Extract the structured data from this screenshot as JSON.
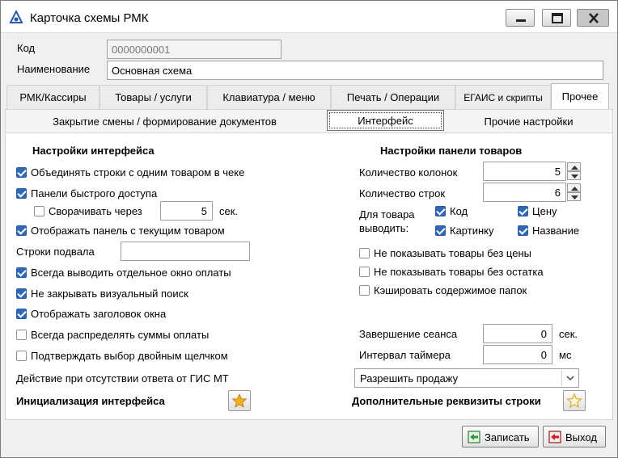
{
  "window": {
    "title": "Карточка схемы РМК"
  },
  "fields": {
    "code_label": "Код",
    "code_value": "0000000001",
    "name_label": "Наименование",
    "name_value": "Основная схема"
  },
  "tabs": [
    {
      "label": "РМК/Кассиры"
    },
    {
      "label": "Товары / услуги"
    },
    {
      "label": "Клавиатура / меню"
    },
    {
      "label": "Печать / Операции"
    },
    {
      "label": "ЕГАИС и скрипты"
    },
    {
      "label": "Прочее",
      "active": true
    }
  ],
  "subtabs": [
    {
      "label": "Закрытие смены / формирование документов"
    },
    {
      "label": "Интерфейс",
      "active": true
    },
    {
      "label": "Прочие настройки"
    }
  ],
  "left": {
    "section_title": "Настройки интерфейса",
    "group_lines": {
      "label": "Объединять строки с одним товаром в чеке",
      "checked": true
    },
    "quick_panels": {
      "label": "Панели быстрого доступа",
      "checked": true
    },
    "collapse": {
      "label": "Сворачивать через",
      "checked": false,
      "value": "5",
      "unit": "сек."
    },
    "show_current": {
      "label": "Отображать панель с текущим товаром",
      "checked": true
    },
    "footer_lines": {
      "label": "Строки подвала",
      "value": ""
    },
    "separate_payment": {
      "label": "Всегда выводить отдельное окно оплаты",
      "checked": true
    },
    "keep_search": {
      "label": "Не закрывать визуальный поиск",
      "checked": true
    },
    "show_header": {
      "label": "Отображать заголовок окна",
      "checked": true
    },
    "distribute_sums": {
      "label": "Всегда распределять суммы оплаты",
      "checked": false
    },
    "confirm_dblclick": {
      "label": "Подтверждать выбор двойным щелчком",
      "checked": false
    },
    "gis_action_label": "Действие при отсутствии ответа от ГИС МТ",
    "init_label": "Инициализация интерфейса"
  },
  "right": {
    "section_title": "Настройки панели товаров",
    "columns": {
      "label": "Количество колонок",
      "value": "5"
    },
    "rows": {
      "label": "Количество строк",
      "value": "6"
    },
    "output_label_1": "Для товара",
    "output_label_2": "выводить:",
    "out_code": {
      "label": "Код",
      "checked": true
    },
    "out_price": {
      "label": "Цену",
      "checked": true
    },
    "out_image": {
      "label": "Картинку",
      "checked": true
    },
    "out_name": {
      "label": "Название",
      "checked": true
    },
    "hide_no_price": {
      "label": "Не показывать товары без цены",
      "checked": false
    },
    "hide_no_stock": {
      "label": "Не показывать товары без остатка",
      "checked": false
    },
    "cache_folders": {
      "label": "Кэшировать содержимое папок",
      "checked": false
    },
    "session_end": {
      "label": "Завершение сеанса",
      "value": "0",
      "unit": "сек."
    },
    "timer": {
      "label": "Интервал таймера",
      "value": "0",
      "unit": "мс"
    },
    "gis_action_value": "Разрешить продажу",
    "extra_props_label": "Дополнительные реквизиты строки"
  },
  "footer": {
    "save_label": "Записать",
    "exit_label": "Выход"
  },
  "colors": {
    "accent": "#2f68b6",
    "star": "#f2b01e"
  }
}
